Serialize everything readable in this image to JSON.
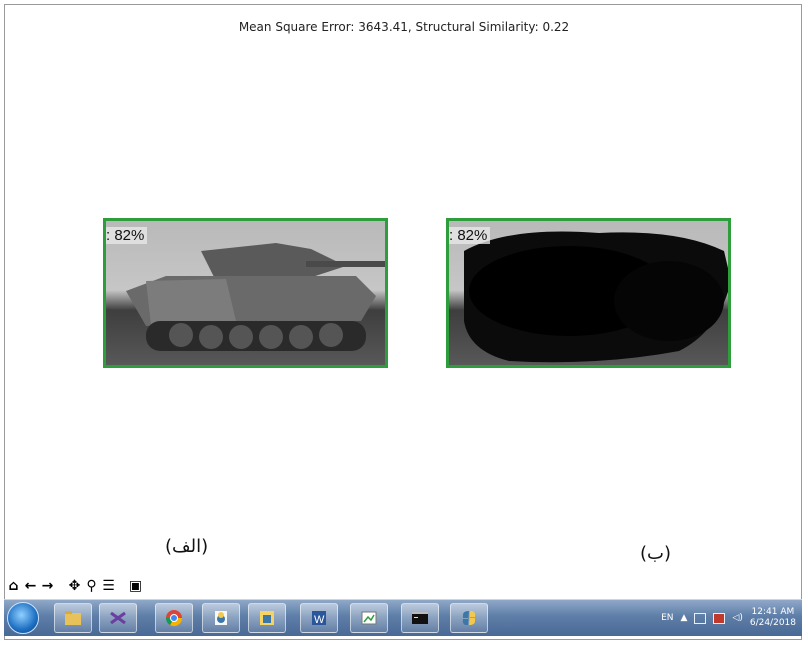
{
  "metrics_title": "Mean Square Error: 3643.41,   Structural Similarity: 0.22",
  "panels": [
    {
      "confidence": ": 82%",
      "caption": "(الف)"
    },
    {
      "confidence": ": 82%",
      "caption": "(ب)"
    }
  ],
  "colors": {
    "box": "#2e9e3c",
    "taskbar": "#5e7ea8"
  },
  "toolbar": {
    "icons": [
      "home-icon",
      "back-icon",
      "forward-icon",
      "pan-icon",
      "zoom-icon",
      "configure-subplots-icon",
      "save-icon"
    ]
  },
  "taskbar": {
    "items": [
      "file-explorer",
      "visual-studio",
      "chrome",
      "python-idle",
      "sticky-notes",
      "word",
      "image-editor",
      "command-prompt",
      "python"
    ],
    "language": "EN",
    "time": "12:41 AM",
    "date": "6/24/2018"
  }
}
